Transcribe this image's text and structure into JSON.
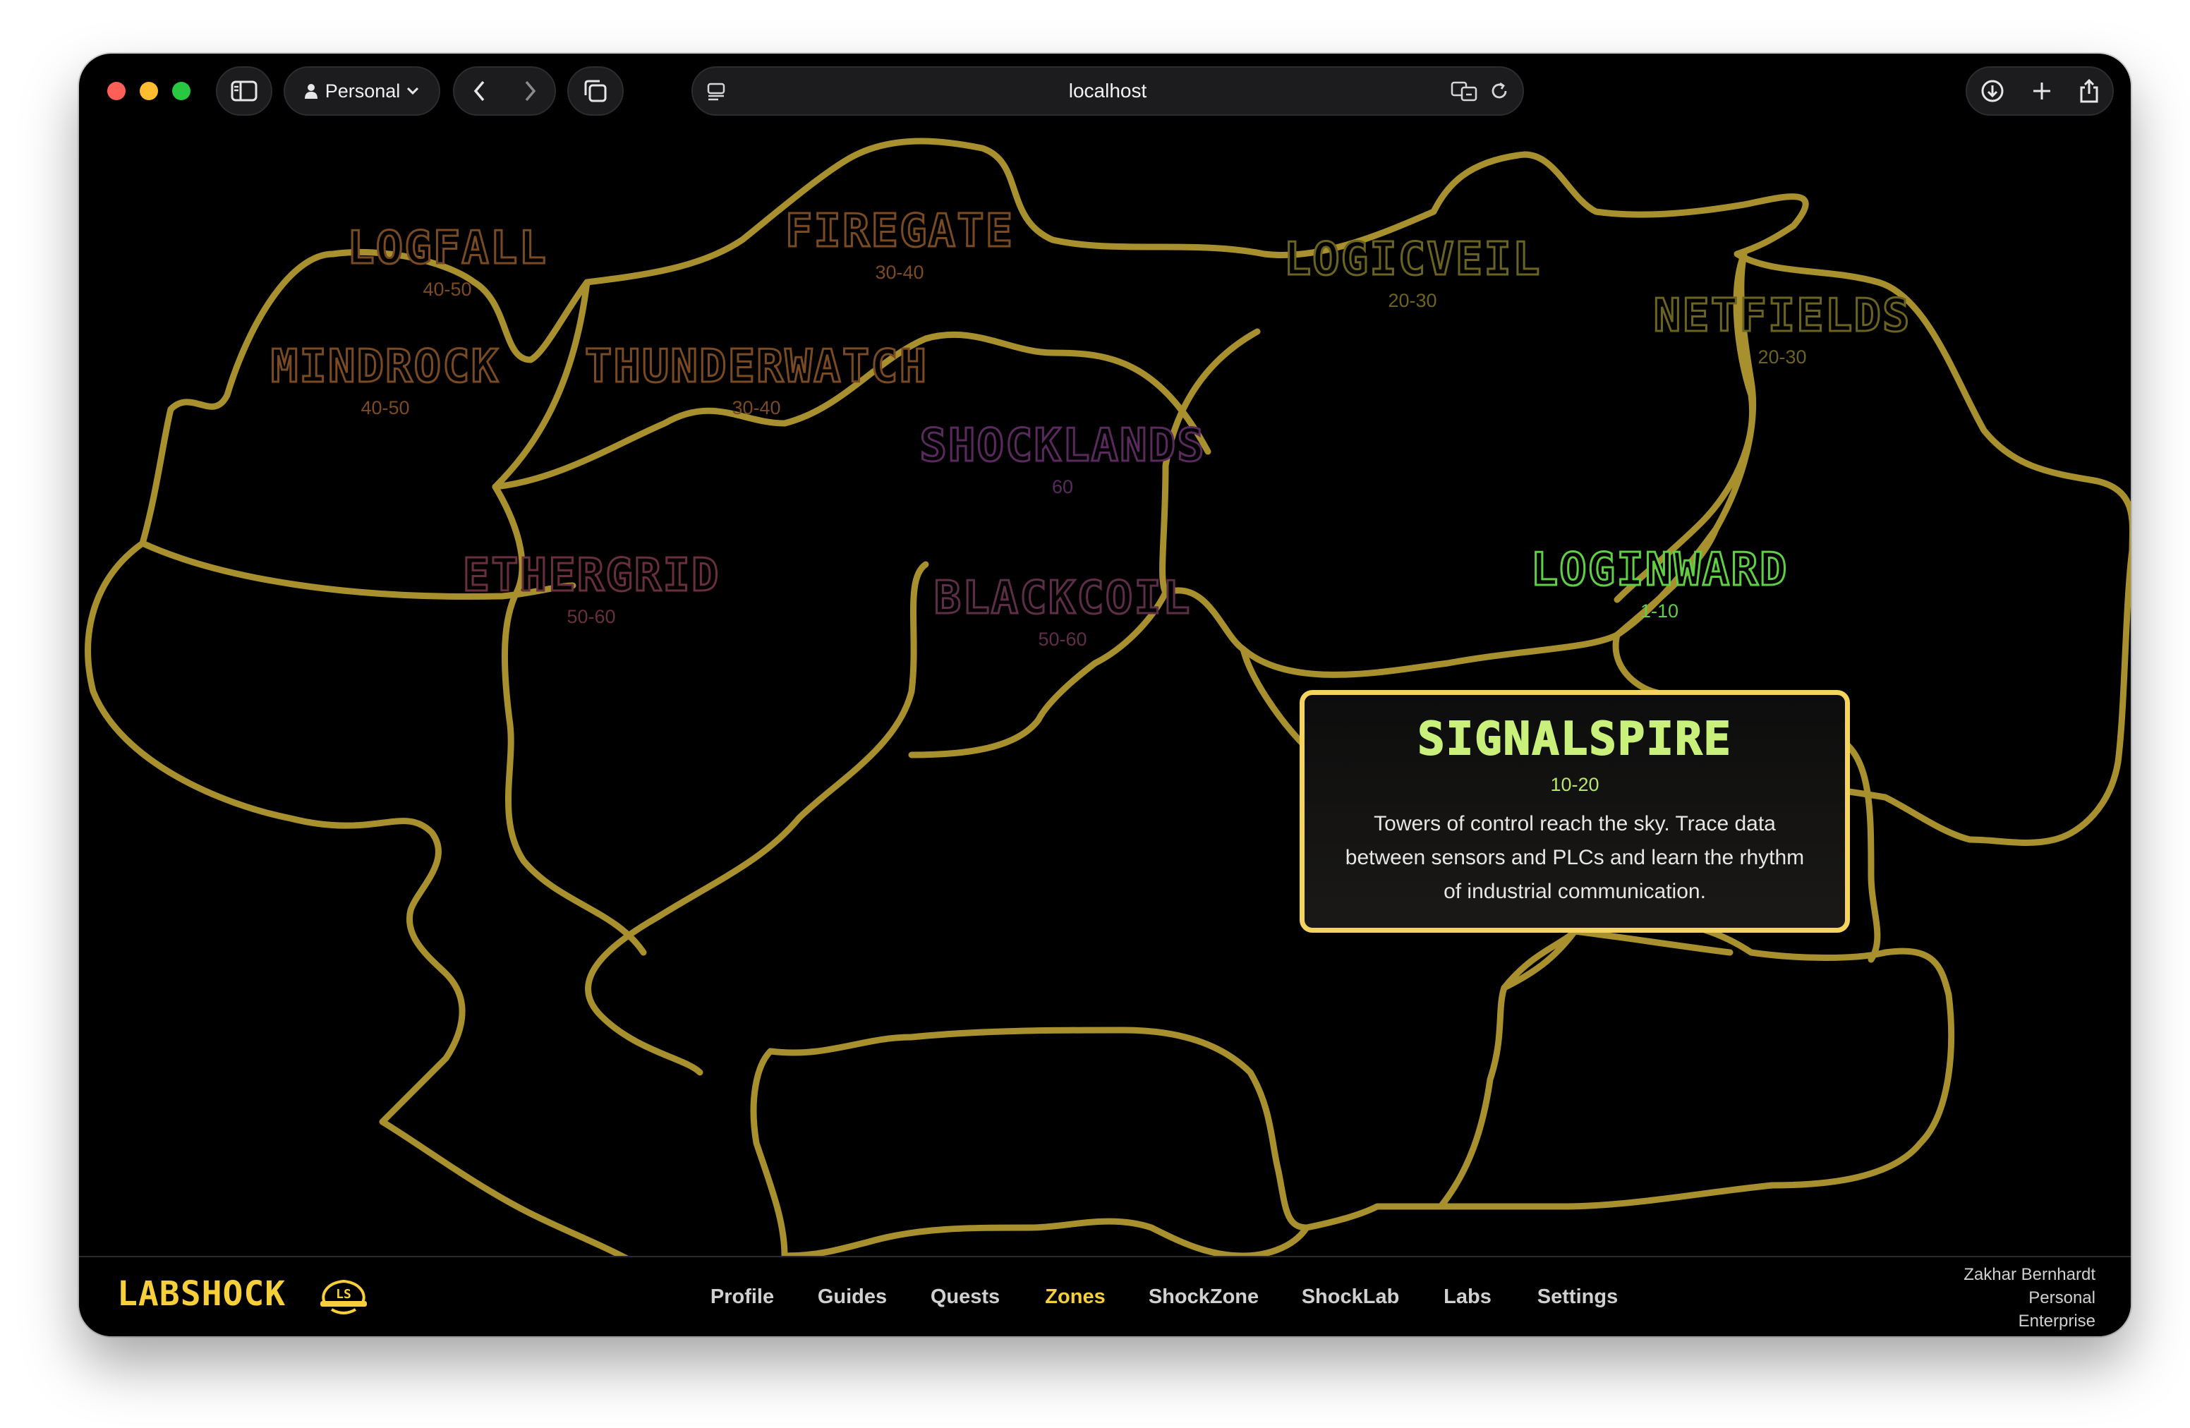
{
  "browser": {
    "profile_label": "Personal",
    "url": "localhost"
  },
  "zones": [
    {
      "id": "logfall",
      "name": "LOGFALL",
      "range": "40-50",
      "color": "#7a4a22"
    },
    {
      "id": "firegate",
      "name": "FIREGATE",
      "range": "30-40",
      "color": "#7a4a22"
    },
    {
      "id": "logicveil",
      "name": "LOGICVEIL",
      "range": "20-30",
      "color": "#6b6420"
    },
    {
      "id": "netfields",
      "name": "NETFIELDS",
      "range": "20-30",
      "color": "#6b6420"
    },
    {
      "id": "mindrock",
      "name": "MINDROCK",
      "range": "40-50",
      "color": "#7a4a22"
    },
    {
      "id": "thunderwatch",
      "name": "THUNDERWATCH",
      "range": "30-40",
      "color": "#7a4a22"
    },
    {
      "id": "shocklands",
      "name": "SHOCKLANDS",
      "range": "60",
      "color": "#5a2a5e"
    },
    {
      "id": "ethergrid",
      "name": "ETHERGRID",
      "range": "50-60",
      "color": "#6a2f3c"
    },
    {
      "id": "blackcoil",
      "name": "BLACKCOIL",
      "range": "50-60",
      "color": "#5e2e48"
    },
    {
      "id": "loginward",
      "name": "LOGINWARD",
      "range": "1-10",
      "color": "#5fcf45"
    }
  ],
  "tooltip": {
    "name": "SIGNALSPIRE",
    "range": "10-20",
    "description": "Towers of control reach the sky. Trace data between sensors and PLCs and learn the rhythm of industrial communication."
  },
  "colors": {
    "border": "#a8902e",
    "accent": "#f6cf3b",
    "tooltip_border": "#f4d35e"
  },
  "bottombar": {
    "brand": "LABSHOCK",
    "logo_text": "LS",
    "nav": [
      "Profile",
      "Guides",
      "Quests",
      "Zones",
      "ShockZone",
      "ShockLab",
      "Labs",
      "Settings"
    ],
    "active": "Zones",
    "user": {
      "name": "Zakhar Bernhardt",
      "line2": "Personal",
      "line3": "Enterprise"
    }
  }
}
